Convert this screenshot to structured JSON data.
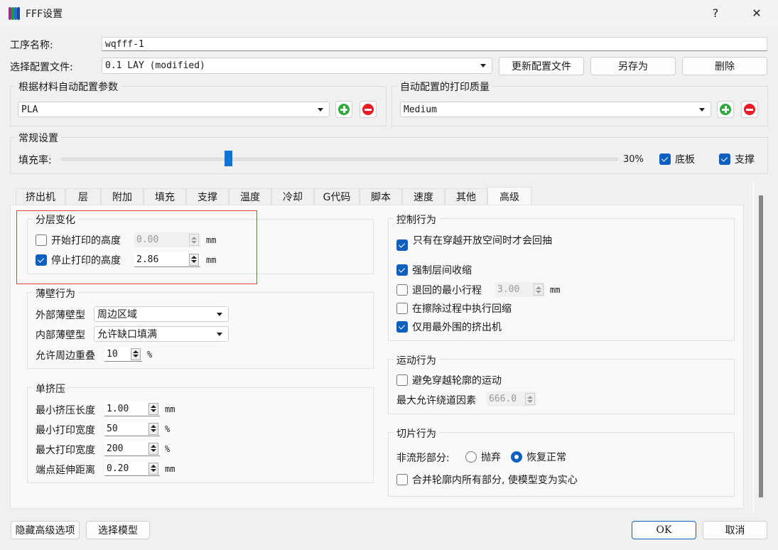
{
  "window": {
    "title": "FFF设置",
    "help_icon": "?",
    "close_icon": "✕",
    "logo_colors": [
      "#b0238c",
      "#1e9a3a",
      "#2a6bd1",
      "#184a9c"
    ]
  },
  "header": {
    "process_name_label": "工序名称:",
    "process_name_value": "wqfff-1",
    "profile_label": "选择配置文件:",
    "profile_value": "0.1 LAY (modified)",
    "update_profile_btn": "更新配置文件",
    "save_as_btn": "另存为",
    "delete_btn": "删除"
  },
  "material_group": {
    "title": "根据材料自动配置参数",
    "value": "PLA"
  },
  "quality_group": {
    "title": "自动配置的打印质量",
    "value": "Medium"
  },
  "general": {
    "title": "常规设置",
    "infill_label": "填充率:",
    "infill_value": "30%",
    "infill_fraction": 0.3,
    "raft_label": "底板",
    "raft_checked": true,
    "support_label": "支撑",
    "support_checked": true
  },
  "tabs": [
    {
      "label": "挤出机",
      "active": false
    },
    {
      "label": "层",
      "active": false
    },
    {
      "label": "附加",
      "active": false
    },
    {
      "label": "填充",
      "active": false
    },
    {
      "label": "支撑",
      "active": false
    },
    {
      "label": "温度",
      "active": false
    },
    {
      "label": "冷却",
      "active": false
    },
    {
      "label": "G代码",
      "active": false
    },
    {
      "label": "脚本",
      "active": false
    },
    {
      "label": "速度",
      "active": false
    },
    {
      "label": "其他",
      "active": false
    },
    {
      "label": "高级",
      "active": true
    }
  ],
  "layer_change": {
    "title": "分层变化",
    "start_label": "开始打印的高度",
    "start_checked": false,
    "start_value": "0.00",
    "start_unit": "mm",
    "stop_label": "停止打印的高度",
    "stop_checked": true,
    "stop_value": "2.86",
    "stop_unit": "mm",
    "highlight_color": "#e53935"
  },
  "thin_wall": {
    "title": "薄壁行为",
    "outer_label": "外部薄壁型",
    "outer_value": "周边区域",
    "inner_label": "内部薄壁型",
    "inner_value": "允许缺口填满",
    "overlap_label": "允许周边重叠",
    "overlap_value": "10",
    "overlap_unit": "%"
  },
  "single_extrusion": {
    "title": "单挤压",
    "rows": [
      {
        "label": "最小挤压长度",
        "value": "1.00",
        "unit": "mm"
      },
      {
        "label": "最小打印宽度",
        "value": "50",
        "unit": "%"
      },
      {
        "label": "最大打印宽度",
        "value": "200",
        "unit": "%"
      },
      {
        "label": "端点延伸距离",
        "value": "0.20",
        "unit": "mm"
      }
    ]
  },
  "control": {
    "title": "控制行为",
    "retract_open_label": "只有在穿越开放空间时才会回抽",
    "retract_open_checked": true,
    "force_retract_label": "强制层间收缩",
    "force_retract_checked": true,
    "min_travel_label": "退回的最小行程",
    "min_travel_checked": false,
    "min_travel_value": "3.00",
    "min_travel_unit": "mm",
    "wipe_retract_label": "在擦除过程中执行回缩",
    "wipe_retract_checked": false,
    "outer_extruder_label": "仅用最外围的挤出机",
    "outer_extruder_checked": true
  },
  "motion": {
    "title": "运动行为",
    "avoid_label": "避免穿越轮廓的运动",
    "avoid_checked": false,
    "detour_label": "最大允许绕道因素",
    "detour_value": "666.0"
  },
  "slicing": {
    "title": "切片行为",
    "nonmanifold_label": "非流形部分:",
    "discard_label": "抛弃",
    "discard_selected": false,
    "restore_label": "恢复正常",
    "restore_selected": true,
    "merge_label": "合并轮廓内所有部分, 使模型变为实心",
    "merge_checked": false
  },
  "footer": {
    "hide_advanced_btn": "隐藏高级选项",
    "select_model_btn": "选择模型",
    "ok_btn": "OK",
    "cancel_btn": "取消"
  }
}
